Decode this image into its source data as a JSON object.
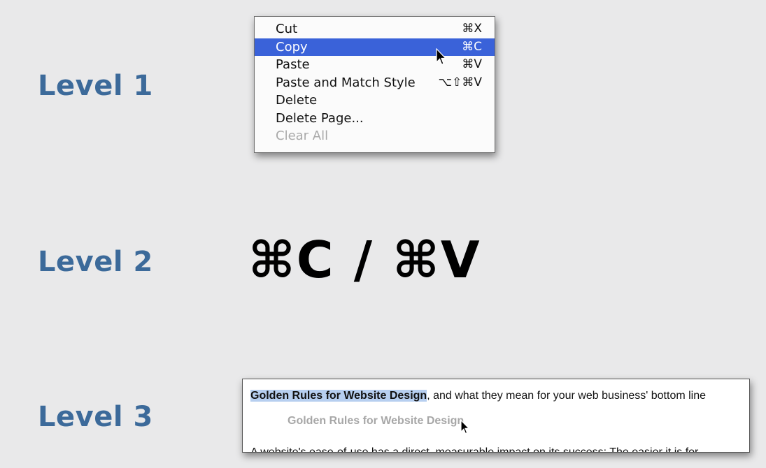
{
  "levels": {
    "level1": "Level 1",
    "level2": "Level 2",
    "level3": "Level 3"
  },
  "context_menu": {
    "items": [
      {
        "label": "Cut",
        "shortcut": "⌘X",
        "state": "normal"
      },
      {
        "label": "Copy",
        "shortcut": "⌘C",
        "state": "selected"
      },
      {
        "label": "Paste",
        "shortcut": "⌘V",
        "state": "normal"
      },
      {
        "label": "Paste and Match Style",
        "shortcut": "⌥⇧⌘V",
        "state": "normal"
      },
      {
        "label": "Delete",
        "shortcut": "",
        "state": "normal"
      },
      {
        "label": "Delete Page...",
        "shortcut": "",
        "state": "normal"
      },
      {
        "label": "Clear All",
        "shortcut": "",
        "state": "disabled"
      }
    ]
  },
  "shortcut_display": "⌘C / ⌘V",
  "document": {
    "highlighted_text": "Golden Rules for Website Design",
    "line1_rest": ", and what they mean for your web business' bottom line",
    "drag_ghost": "Golden Rules for Website Design",
    "paragraph": "A website's ease-of-use has a direct, measurable impact on its success: The easier it is for"
  },
  "colors": {
    "label_blue": "#3c6a9a",
    "menu_selection": "#3a62d9",
    "text_highlight": "#b7cff0"
  },
  "icons": [
    "arrow-cursor-icon"
  ]
}
